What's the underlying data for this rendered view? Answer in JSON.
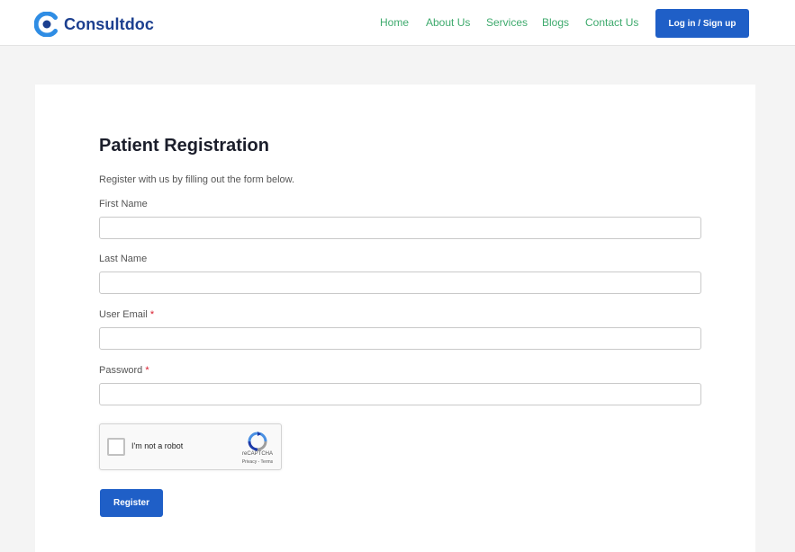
{
  "header": {
    "brand": "Consultdoc",
    "brand_color": "#1c3f8f",
    "nav": [
      {
        "label": "Home"
      },
      {
        "label": "About Us"
      },
      {
        "label": "Services"
      },
      {
        "label": "Blogs"
      },
      {
        "label": "Contact Us"
      }
    ],
    "nav_color": "#3eaa6d",
    "login_label": "Log in / Sign up",
    "accent": "#1f5fc7"
  },
  "form": {
    "title": "Patient Registration",
    "subtitle": "Register with us by filling out the form below.",
    "fields": [
      {
        "label": "First Name",
        "required": false,
        "value": ""
      },
      {
        "label": "Last Name",
        "required": false,
        "value": ""
      },
      {
        "label": "User Email",
        "required": true,
        "value": ""
      },
      {
        "label": "Password",
        "required": true,
        "value": ""
      }
    ],
    "required_marker": "*",
    "captcha": {
      "label": "I'm not a robot",
      "brand": "reCAPTCHA",
      "links": "Privacy - Terms",
      "checked": false
    },
    "submit_label": "Register"
  }
}
